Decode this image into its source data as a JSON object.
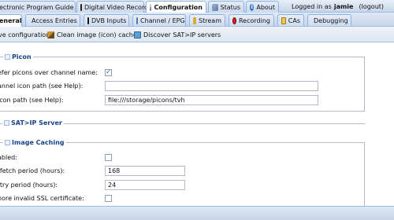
{
  "top_tabs": [
    {
      "label": "ectronic Program Guide",
      "icon": "epg-icon"
    },
    {
      "label": "Digital Video Recorder",
      "icon": "film-icon"
    },
    {
      "label": "Configuration",
      "icon": "wrench-icon"
    },
    {
      "label": "Status",
      "icon": "status-icon"
    },
    {
      "label": "About",
      "icon": "info-icon"
    }
  ],
  "login": {
    "prefix": "Logged in as",
    "user": "jamie",
    "logout": "(logout)"
  },
  "sub_tabs": [
    {
      "label": "eneral",
      "icon": "gear-icon"
    },
    {
      "label": "Access Entries",
      "icon": "key-icon"
    },
    {
      "label": "DVB Inputs",
      "icon": "tv-icon"
    },
    {
      "label": "Channel / EPG",
      "icon": "grid-icon"
    },
    {
      "label": "Stream",
      "icon": "speaker-icon"
    },
    {
      "label": "Recording",
      "icon": "record-icon"
    },
    {
      "label": "CAs",
      "icon": "ca-icon"
    },
    {
      "label": "Debugging",
      "icon": "debug-icon"
    }
  ],
  "toolbar": {
    "save_label": "ve configuration",
    "clean_cache_label": "Clean image (icon) cache",
    "discover_label": "Discover SAT>IP servers"
  },
  "picon": {
    "title": "Picon",
    "prefer_label": "efer picons over channel name:",
    "prefer_checked": true,
    "channel_icon_label": "annel icon path (see Help):",
    "channel_icon_value": "",
    "picon_path_label": "icon path (see Help):",
    "picon_path_value": "file:///storage/picons/tvh"
  },
  "satip": {
    "title": "SAT>IP Server"
  },
  "image_caching": {
    "title": "Image Caching",
    "enabled_label": "abled:",
    "enabled_checked": false,
    "refetch_label": "-fetch period (hours):",
    "refetch_value": "168",
    "retry_label": "-try period (hours):",
    "retry_value": "24",
    "ignore_ssl_label": "nore invalid SSL certificate:",
    "ignore_ssl_checked": false
  },
  "colors": {
    "accent": "#15428b",
    "tab_border": "#8db2e3",
    "bar": "#c6d5ea"
  }
}
